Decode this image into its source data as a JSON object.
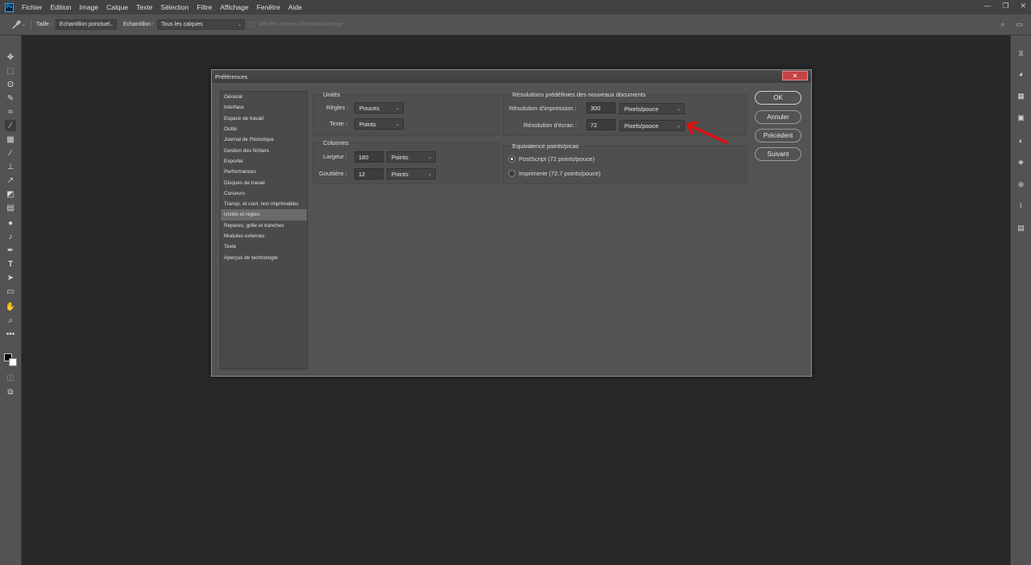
{
  "menubar": {
    "logo": "Ps",
    "items": [
      "Fichier",
      "Edition",
      "Image",
      "Calque",
      "Texte",
      "Sélection",
      "Filtre",
      "Affichage",
      "Fenêtre",
      "Aide"
    ]
  },
  "options_bar": {
    "size_label": "Taille :",
    "size_value": "Echantillon ponctuel",
    "sample_label": "Echantillon :",
    "sample_value": "Tous les calques",
    "show_ring_label": "Afficher anneau d'échantillonnage"
  },
  "dialog": {
    "title": "Préférences",
    "close_label": "✕",
    "nav": [
      "Général",
      "Interface",
      "Espace de travail",
      "Outils",
      "Journal de l'historique",
      "Gestion des fichiers",
      "Exporter",
      "Performances",
      "Disques de travail",
      "Curseurs",
      "Transp. et coul. non imprimables",
      "Unités et règles",
      "Repères, grille et tranches",
      "Modules externes",
      "Texte",
      "Aperçus de technologie"
    ],
    "nav_selected": "Unités et règles",
    "units": {
      "heading": "Unités",
      "rulers_label": "Règles :",
      "rulers_value": "Pouces",
      "type_label": "Texte :",
      "type_value": "Points"
    },
    "columns": {
      "heading": "Colonnes",
      "width_label": "Largeur :",
      "width_value": "180",
      "width_unit": "Points",
      "gutter_label": "Gouttière :",
      "gutter_value": "12",
      "gutter_unit": "Points"
    },
    "resolutions": {
      "heading": "Résolutions prédéfinies des nouveaux documents",
      "print_label": "Résolution d'impression :",
      "print_value": "300",
      "print_unit": "Pixels/pouce",
      "screen_label": "Résolution d'écran :",
      "screen_value": "72",
      "screen_unit": "Pixels/pouce"
    },
    "point_size": {
      "heading": "Equivalence points/picas",
      "option_postscript": "PostScript (72 points/pouce)",
      "option_traditional": "Imprimerie (72,7 points/pouce)",
      "selected": "PostScript (72 points/pouce)"
    },
    "buttons": {
      "ok": "OK",
      "cancel": "Annuler",
      "prev": "Précédent",
      "next": "Suivant"
    },
    "annotation_color": "#e01010"
  }
}
